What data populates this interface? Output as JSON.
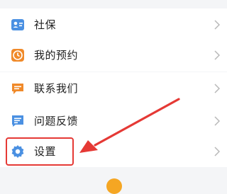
{
  "menu": {
    "items": [
      {
        "label": "社保",
        "icon": "id-card-icon"
      },
      {
        "label": "我的预约",
        "icon": "clock-icon"
      },
      {
        "label": "联系我们",
        "icon": "chat-bubble-icon"
      },
      {
        "label": "问题反馈",
        "icon": "feedback-icon"
      },
      {
        "label": "设置",
        "icon": "gear-icon"
      }
    ]
  },
  "colors": {
    "accent_blue": "#4a90e2",
    "accent_orange": "#f08a2a",
    "annotation_red": "#e53935",
    "background": "#f4f5f7"
  }
}
